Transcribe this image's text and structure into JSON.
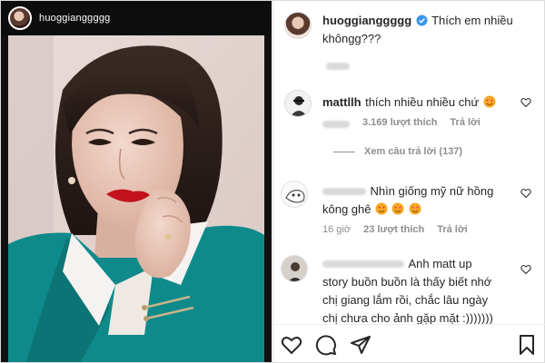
{
  "story": {
    "username": "huoggianggggg"
  },
  "post": {
    "author": "huoggianggggg",
    "caption": "Thích em nhiều",
    "caption_line2": "khôngg???"
  },
  "comments": [
    {
      "username": "mattllh",
      "text": "thích nhiều nhiều chứ",
      "likes": "3.169 lượt thích",
      "reply_label": "Trả lời",
      "view_replies": "Xem câu trả lời (137)"
    },
    {
      "text_line1": "Nhìn giống mỹ nữ hồng",
      "text_line2": "kông ghê",
      "time": "16 giờ",
      "likes": "23 lượt thích",
      "reply_label": "Trả lời"
    },
    {
      "text_line1": "Anh matt up",
      "text_line2": "story buồn buồn là thấy biết nhớ",
      "text_line3": "chị giang lắm rồi, chắc lâu ngày",
      "text_line4": "chị chưa cho ảnh gặp mặt :)))))))"
    }
  ],
  "icons": {
    "like": "heart-icon",
    "comment": "comment-icon",
    "share": "send-icon",
    "save": "bookmark-icon"
  },
  "colors": {
    "verified": "#3897f0",
    "emoji": "#f5a623",
    "meta_text": "#8e8e8e"
  }
}
